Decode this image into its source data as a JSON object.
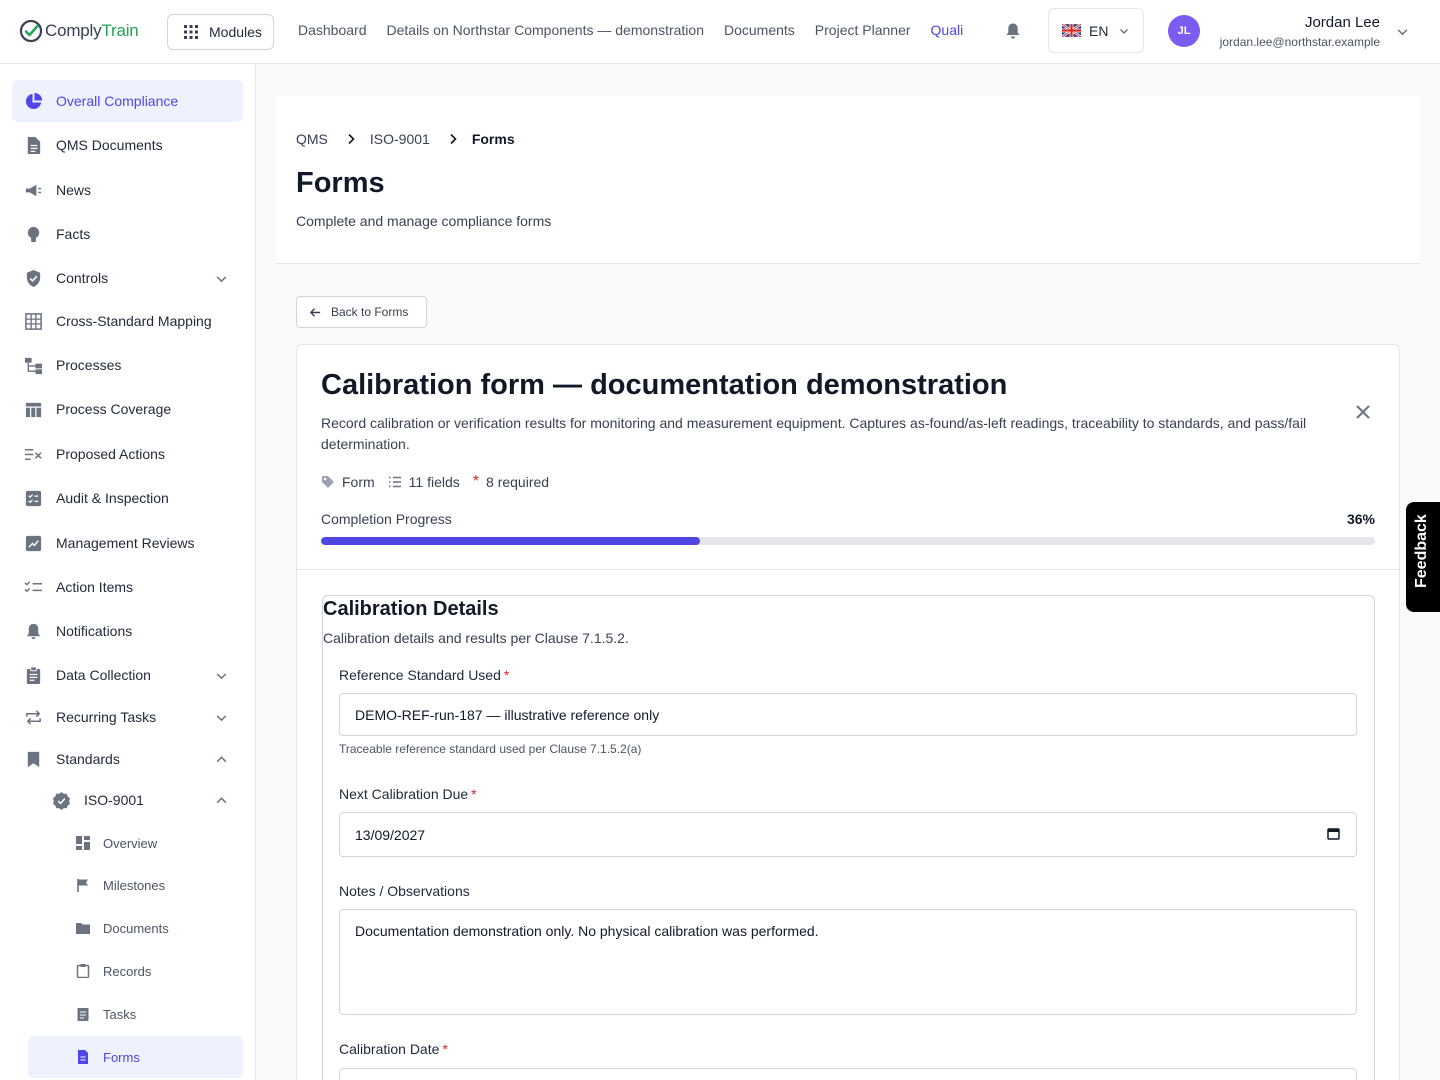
{
  "app": {
    "logo_part1": "Comply",
    "logo_part2": "Train",
    "modules_label": "Modules"
  },
  "topnav": {
    "items": [
      "Dashboard",
      "Details on Northstar Components — demonstration",
      "Documents",
      "Project Planner",
      "Quali"
    ]
  },
  "language": {
    "code": "EN"
  },
  "user": {
    "initials": "JL",
    "name": "Jordan Lee",
    "email": "jordan.lee@northstar.example"
  },
  "sidebar": {
    "items": [
      {
        "label": "Overall Compliance",
        "icon": "pie-chart-icon",
        "active": true
      },
      {
        "label": "QMS Documents",
        "icon": "document-icon"
      },
      {
        "label": "News",
        "icon": "megaphone-icon"
      },
      {
        "label": "Facts",
        "icon": "lightbulb-icon"
      },
      {
        "label": "Controls",
        "icon": "shield-icon",
        "chevron": "down"
      },
      {
        "label": "Cross-Standard Mapping",
        "icon": "grid-icon"
      },
      {
        "label": "Processes",
        "icon": "flow-icon"
      },
      {
        "label": "Process Coverage",
        "icon": "table-icon"
      },
      {
        "label": "Proposed Actions",
        "icon": "list-x-icon"
      },
      {
        "label": "Audit & Inspection",
        "icon": "checklist-icon"
      },
      {
        "label": "Management Reviews",
        "icon": "review-icon"
      },
      {
        "label": "Action Items",
        "icon": "list-check-icon"
      },
      {
        "label": "Notifications",
        "icon": "bell-icon"
      },
      {
        "label": "Data Collection",
        "icon": "clipboard-icon",
        "chevron": "down"
      },
      {
        "label": "Recurring Tasks",
        "icon": "repeat-icon",
        "chevron": "down"
      },
      {
        "label": "Standards",
        "icon": "bookmark-icon",
        "chevron": "up"
      }
    ],
    "standard": {
      "label": "ISO-9001",
      "icon": "badge-check-icon",
      "chevron": "up"
    },
    "sub_items": [
      {
        "label": "Overview",
        "icon": "dashboard-icon"
      },
      {
        "label": "Milestones",
        "icon": "flag-icon"
      },
      {
        "label": "Documents",
        "icon": "folder-icon"
      },
      {
        "label": "Records",
        "icon": "clipboard-icon"
      },
      {
        "label": "Tasks",
        "icon": "task-icon"
      },
      {
        "label": "Forms",
        "icon": "form-icon",
        "active": true
      }
    ]
  },
  "breadcrumb": [
    "QMS",
    "ISO-9001",
    "Forms"
  ],
  "page": {
    "title": "Forms",
    "subtitle": "Complete and manage compliance forms",
    "back_label": "Back to Forms"
  },
  "form": {
    "title": "Calibration form — documentation demonstration",
    "description": "Record calibration or verification results for monitoring and measurement equipment. Captures as-found/as-left readings, traceability to standards, and pass/fail determination.",
    "meta_type": "Form",
    "meta_fields": "11 fields",
    "meta_required": "8 required",
    "progress_label": "Completion Progress",
    "progress_text": "36%",
    "progress_fraction": 0.36,
    "section_title": "Calibration Details",
    "section_desc": "Calibration details and results per Clause 7.1.5.2.",
    "fields": {
      "ref_label": "Reference Standard Used",
      "ref_value": "DEMO-REF-run-187 — illustrative reference only",
      "ref_hint": "Traceable reference standard used per Clause 7.1.5.2(a)",
      "next_label": "Next Calibration Due",
      "next_value": "13/09/2027",
      "notes_label": "Notes / Observations",
      "notes_value": "Documentation demonstration only. No physical calibration was performed.",
      "cal_date_label": "Calibration Date"
    }
  },
  "feedback_label": "Feedback",
  "colors": {
    "accent": "#4f46e5",
    "logo_green": "#22a554",
    "avatar": "#7c5cf0",
    "required": "#dc2626"
  }
}
